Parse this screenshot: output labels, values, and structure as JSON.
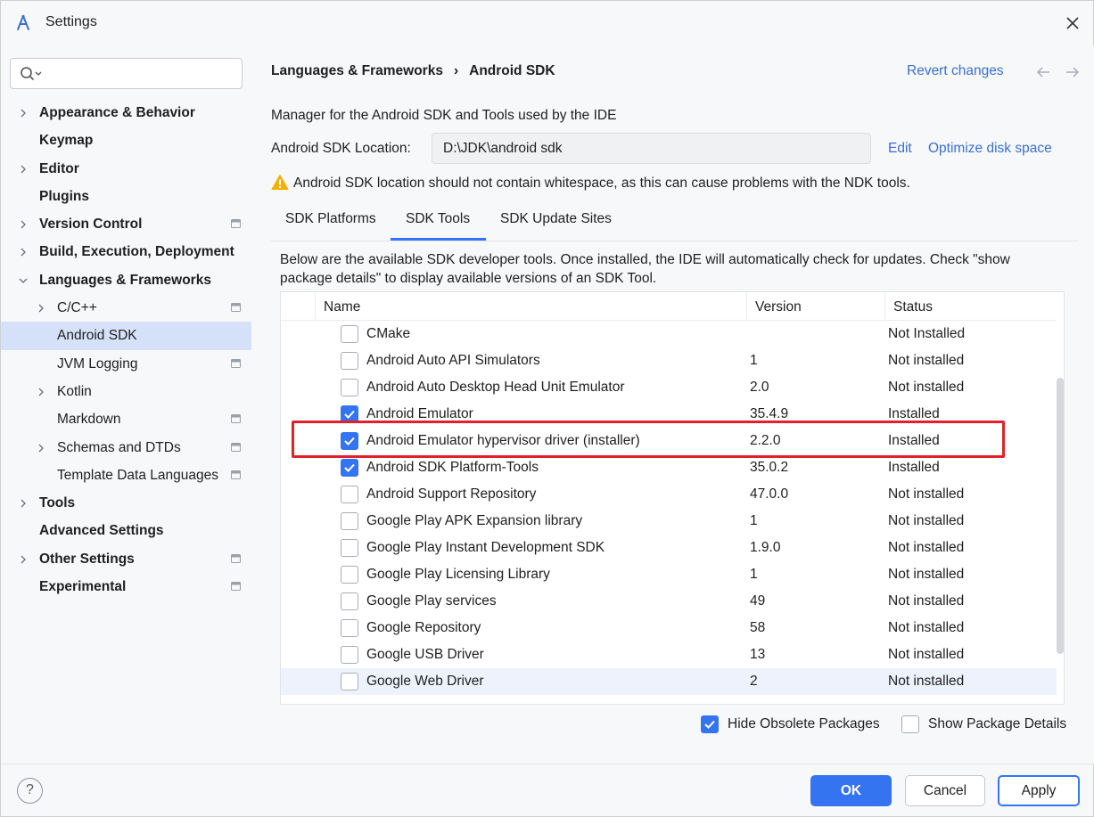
{
  "window": {
    "title": "Settings"
  },
  "search": {
    "placeholder": ""
  },
  "sidebar": {
    "items": [
      {
        "label": "Appearance & Behavior",
        "bold": true,
        "level": 0,
        "expandable": true,
        "expanded": false,
        "project": false
      },
      {
        "label": "Keymap",
        "bold": true,
        "level": 0,
        "expandable": false,
        "project": false
      },
      {
        "label": "Editor",
        "bold": true,
        "level": 0,
        "expandable": true,
        "expanded": false,
        "project": false
      },
      {
        "label": "Plugins",
        "bold": true,
        "level": 0,
        "expandable": false,
        "project": false
      },
      {
        "label": "Version Control",
        "bold": true,
        "level": 0,
        "expandable": true,
        "expanded": false,
        "project": true
      },
      {
        "label": "Build, Execution, Deployment",
        "bold": true,
        "level": 0,
        "expandable": true,
        "expanded": false,
        "project": false
      },
      {
        "label": "Languages & Frameworks",
        "bold": true,
        "level": 0,
        "expandable": true,
        "expanded": true,
        "project": false
      },
      {
        "label": "C/C++",
        "bold": false,
        "level": 1,
        "expandable": true,
        "expanded": false,
        "project": true
      },
      {
        "label": "Android SDK",
        "bold": false,
        "level": 1,
        "expandable": false,
        "project": false,
        "selected": true
      },
      {
        "label": "JVM Logging",
        "bold": false,
        "level": 1,
        "expandable": false,
        "project": true
      },
      {
        "label": "Kotlin",
        "bold": false,
        "level": 1,
        "expandable": true,
        "expanded": false,
        "project": false
      },
      {
        "label": "Markdown",
        "bold": false,
        "level": 1,
        "expandable": false,
        "project": true
      },
      {
        "label": "Schemas and DTDs",
        "bold": false,
        "level": 1,
        "expandable": true,
        "expanded": false,
        "project": true
      },
      {
        "label": "Template Data Languages",
        "bold": false,
        "level": 1,
        "expandable": false,
        "project": true
      },
      {
        "label": "Tools",
        "bold": true,
        "level": 0,
        "expandable": true,
        "expanded": false,
        "project": false
      },
      {
        "label": "Advanced Settings",
        "bold": true,
        "level": 0,
        "expandable": false,
        "project": false
      },
      {
        "label": "Other Settings",
        "bold": true,
        "level": 0,
        "expandable": true,
        "expanded": false,
        "project": true
      },
      {
        "label": "Experimental",
        "bold": true,
        "level": 0,
        "expandable": false,
        "project": true
      }
    ]
  },
  "header": {
    "breadcrumb_parent": "Languages & Frameworks",
    "breadcrumb_sep": "›",
    "breadcrumb_current": "Android SDK",
    "revert_label": "Revert changes"
  },
  "main": {
    "description": "Manager for the Android SDK and Tools used by the IDE",
    "location_label": "Android SDK Location:",
    "location_value": "D:\\JDK\\android sdk",
    "edit_label": "Edit",
    "optimize_label": "Optimize disk space",
    "warning": "Android SDK location should not contain whitespace, as this can cause problems with the NDK tools.",
    "tabs": [
      {
        "label": "SDK Platforms",
        "active": false
      },
      {
        "label": "SDK Tools",
        "active": true
      },
      {
        "label": "SDK Update Sites",
        "active": false
      }
    ],
    "panel_description": "Below are the available SDK developer tools. Once installed, the IDE will automatically check for updates. Check \"show package details\" to display available versions of an SDK Tool."
  },
  "table": {
    "columns": {
      "name": "Name",
      "version": "Version",
      "status": "Status"
    },
    "rows": [
      {
        "name": "CMake",
        "version": "",
        "status": "Not Installed",
        "checked": false
      },
      {
        "name": "Android Auto API Simulators",
        "version": "1",
        "status": "Not installed",
        "checked": false
      },
      {
        "name": "Android Auto Desktop Head Unit Emulator",
        "version": "2.0",
        "status": "Not installed",
        "checked": false
      },
      {
        "name": "Android Emulator",
        "version": "35.4.9",
        "status": "Installed",
        "checked": true
      },
      {
        "name": "Android Emulator hypervisor driver (installer)",
        "version": "2.2.0",
        "status": "Installed",
        "checked": true,
        "highlighted": true
      },
      {
        "name": "Android SDK Platform-Tools",
        "version": "35.0.2",
        "status": "Installed",
        "checked": true
      },
      {
        "name": "Android Support Repository",
        "version": "47.0.0",
        "status": "Not installed",
        "checked": false
      },
      {
        "name": "Google Play APK Expansion library",
        "version": "1",
        "status": "Not installed",
        "checked": false
      },
      {
        "name": "Google Play Instant Development SDK",
        "version": "1.9.0",
        "status": "Not installed",
        "checked": false
      },
      {
        "name": "Google Play Licensing Library",
        "version": "1",
        "status": "Not installed",
        "checked": false
      },
      {
        "name": "Google Play services",
        "version": "49",
        "status": "Not installed",
        "checked": false
      },
      {
        "name": "Google Repository",
        "version": "58",
        "status": "Not installed",
        "checked": false
      },
      {
        "name": "Google USB Driver",
        "version": "13",
        "status": "Not installed",
        "checked": false
      },
      {
        "name": "Google Web Driver",
        "version": "2",
        "status": "Not installed",
        "checked": false,
        "hover": true
      }
    ]
  },
  "options": {
    "hide_obsolete": {
      "label": "Hide Obsolete Packages",
      "checked": true
    },
    "show_details": {
      "label": "Show Package Details",
      "checked": false
    }
  },
  "footer": {
    "help_label": "?",
    "ok_label": "OK",
    "cancel_label": "Cancel",
    "apply_label": "Apply"
  },
  "colors": {
    "accent": "#3574f0",
    "link": "#3a6fd1",
    "selection": "#d5e1f8",
    "highlight_box": "#e0202a",
    "warning": "#f2b100"
  }
}
